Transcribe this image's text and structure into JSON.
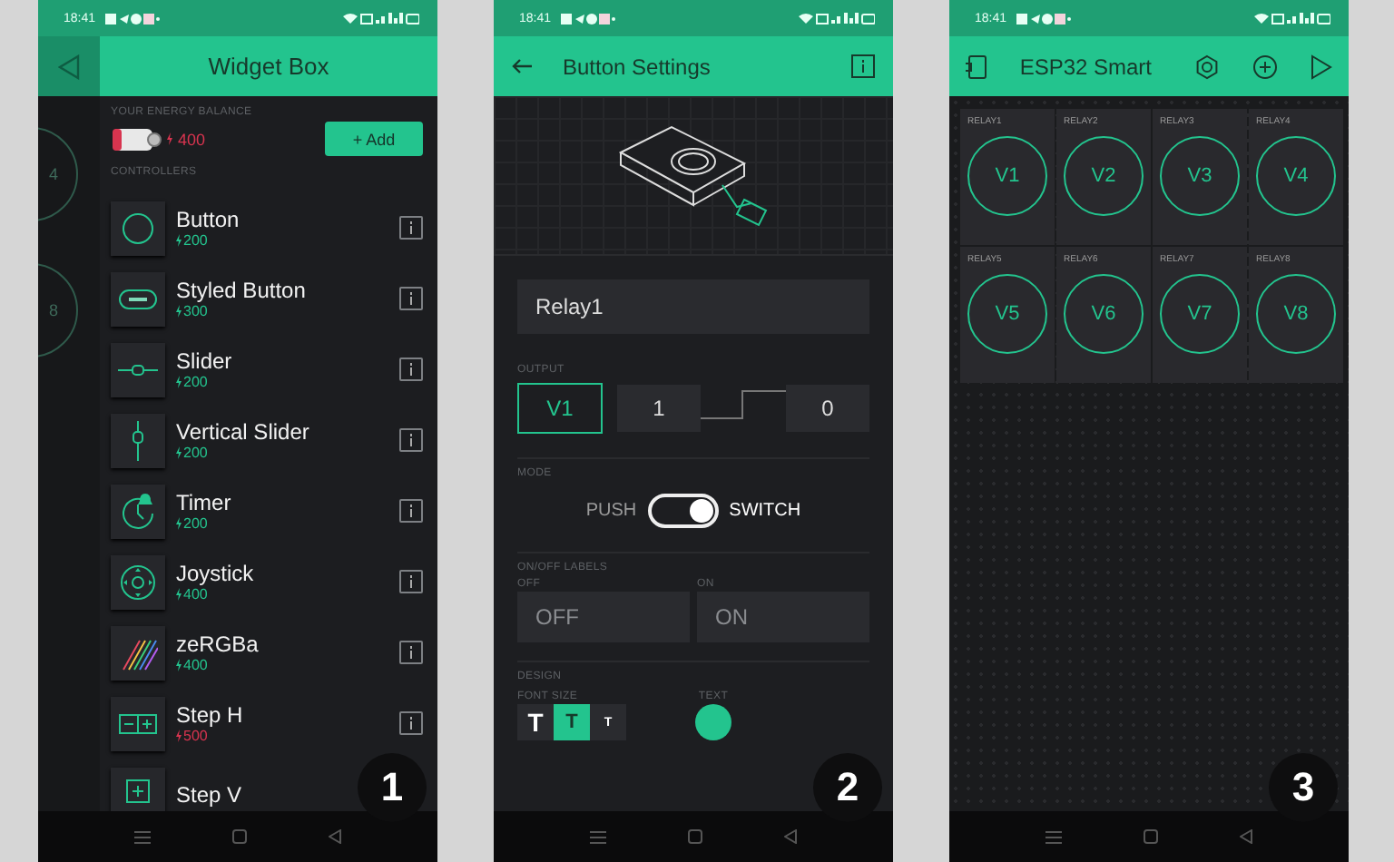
{
  "screens": [
    {
      "kind": "widget_box",
      "time": "18:41",
      "title": "Widget Box",
      "behind_labels": [
        "4",
        "8"
      ],
      "energy_label": "YOUR ENERGY BALANCE",
      "energy": "400",
      "add_button": "+ Add",
      "section": "CONTROLLERS",
      "widgets": [
        {
          "name": "Button",
          "cost": "200",
          "color": "#23c48e"
        },
        {
          "name": "Styled Button",
          "cost": "300",
          "color": "#23c48e"
        },
        {
          "name": "Slider",
          "cost": "200",
          "color": "#23c48e"
        },
        {
          "name": "Vertical Slider",
          "cost": "200",
          "color": "#23c48e"
        },
        {
          "name": "Timer",
          "cost": "200",
          "color": "#23c48e"
        },
        {
          "name": "Joystick",
          "cost": "400",
          "color": "#23c48e"
        },
        {
          "name": "zeRGBa",
          "cost": "400",
          "color": "#23c48e"
        },
        {
          "name": "Step H",
          "cost": "500",
          "color": "#d8344f"
        },
        {
          "name": "Step V"
        }
      ],
      "badge": "1"
    },
    {
      "kind": "settings",
      "time": "18:41",
      "title": "Button Settings",
      "name_value": "Relay1",
      "output_label": "OUTPUT",
      "pin": "V1",
      "high": "1",
      "low": "0",
      "mode_label": "MODE",
      "mode_off": "PUSH",
      "mode_on": "SWITCH",
      "switch_on": true,
      "labels_label": "ON/OFF LABELS",
      "off_label": "OFF",
      "off_value": "OFF",
      "on_label": "ON",
      "on_value": "ON",
      "design_label": "DESIGN",
      "font_size_label": "FONT SIZE",
      "font_sizes": [
        {
          "label": "T",
          "selected": false
        },
        {
          "label": "T",
          "selected": true
        },
        {
          "label": "T",
          "selected": false
        }
      ],
      "text_label": "TEXT",
      "badge": "2"
    },
    {
      "kind": "dashboard",
      "time": "18:41",
      "title": "ESP32 Smart",
      "tiles": [
        {
          "label": "RELAY1",
          "pin": "V1"
        },
        {
          "label": "RELAY2",
          "pin": "V2"
        },
        {
          "label": "RELAY3",
          "pin": "V3"
        },
        {
          "label": "RELAY4",
          "pin": "V4"
        },
        {
          "label": "RELAY5",
          "pin": "V5"
        },
        {
          "label": "RELAY6",
          "pin": "V6"
        },
        {
          "label": "RELAY7",
          "pin": "V7"
        },
        {
          "label": "RELAY8",
          "pin": "V8"
        }
      ],
      "badge": "3"
    }
  ]
}
